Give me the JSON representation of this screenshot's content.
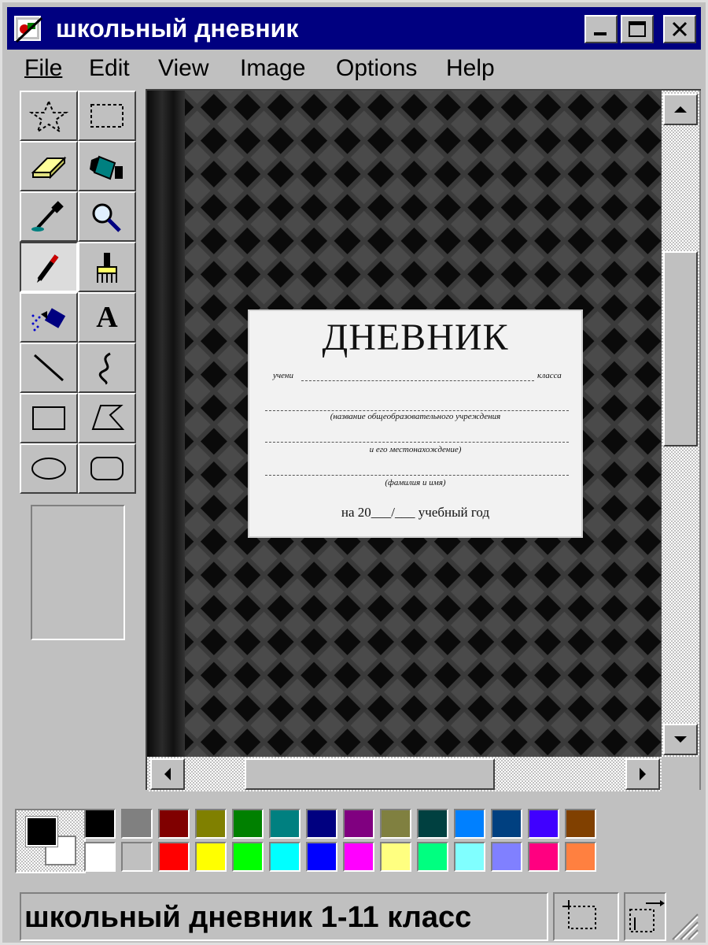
{
  "window": {
    "title": "школьный дневник"
  },
  "menu": [
    "File",
    "Edit",
    "View",
    "Image",
    "Options",
    "Help"
  ],
  "tools": [
    {
      "name": "free-form-select-icon"
    },
    {
      "name": "rect-select-icon"
    },
    {
      "name": "eraser-icon"
    },
    {
      "name": "fill-bucket-icon"
    },
    {
      "name": "eyedropper-icon"
    },
    {
      "name": "magnifier-icon"
    },
    {
      "name": "pencil-icon",
      "pressed": true
    },
    {
      "name": "brush-icon"
    },
    {
      "name": "airbrush-icon"
    },
    {
      "name": "text-icon",
      "glyph": "A"
    },
    {
      "name": "line-icon"
    },
    {
      "name": "curve-icon"
    },
    {
      "name": "rectangle-icon"
    },
    {
      "name": "polygon-icon"
    },
    {
      "name": "ellipse-icon"
    },
    {
      "name": "rounded-rect-icon"
    }
  ],
  "canvas": {
    "title": "ДНЕВНИК",
    "student_prefix": "учени",
    "class_suffix": "класса",
    "caption_school": "(название общеобразовательного учреждения",
    "caption_location": "и его местонахождение)",
    "caption_name": "(фамилия и имя)",
    "year_line": "на 20___/___ учебный год"
  },
  "palette": {
    "foreground": "#000000",
    "background": "#ffffff",
    "top_row": [
      "#000000",
      "#808080",
      "#800000",
      "#808000",
      "#008000",
      "#008080",
      "#000080",
      "#800080",
      "#808040",
      "#004040",
      "#0080ff",
      "#004080",
      "#4000ff",
      "#804000"
    ],
    "bottom_row": [
      "#ffffff",
      "#c0c0c0",
      "#ff0000",
      "#ffff00",
      "#00ff00",
      "#00ffff",
      "#0000ff",
      "#ff00ff",
      "#ffff80",
      "#00ff80",
      "#80ffff",
      "#8080ff",
      "#ff0080",
      "#ff8040"
    ]
  },
  "status": {
    "text": "школьный дневник 1-11 класс"
  }
}
